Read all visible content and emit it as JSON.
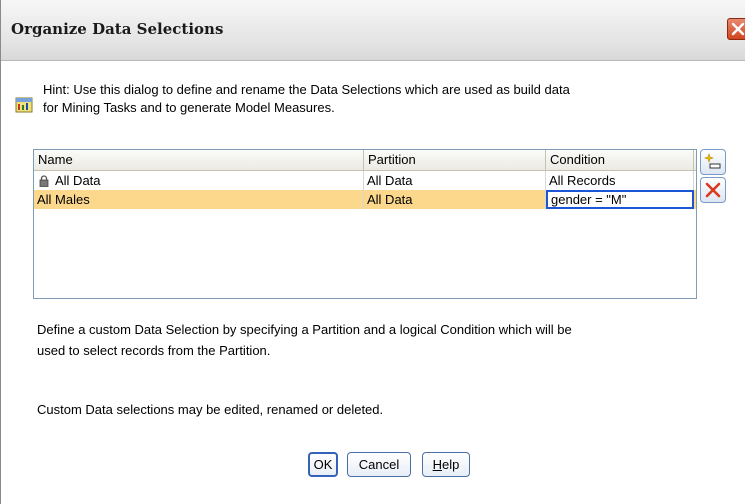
{
  "dialog": {
    "title": "Organize Data Selections",
    "hint_line1": "Hint: Use this dialog to define and rename the Data Selections which are used as build data",
    "hint_line2": "for Mining Tasks and to generate Model Measures.",
    "description_line1": "Define a custom Data Selection by specifying a Partition and a logical Condition which will be",
    "description_line2": "used to select records from the Partition.",
    "note": "Custom Data selections may be edited, renamed or deleted."
  },
  "table": {
    "columns": [
      "Name",
      "Partition",
      "Condition"
    ],
    "rows": [
      {
        "name": "All Data",
        "partition": "All Data",
        "condition": "All Records",
        "locked": true,
        "selected": false
      },
      {
        "name": "All Males",
        "partition": "All Data",
        "condition": "gender = \"M\"",
        "locked": false,
        "selected": true
      }
    ]
  },
  "buttons": {
    "ok": "OK",
    "cancel": "Cancel",
    "help_mnemonic": "H",
    "help_rest": "elp"
  },
  "icons": {
    "close": "close-icon",
    "hint": "hint-icon",
    "lock": "lock-icon",
    "add": "add-selection-icon",
    "delete": "delete-icon"
  },
  "colors": {
    "selected_row": "#fbd88c",
    "delete_red": "#d9381e",
    "close_button": "#d2441f"
  }
}
